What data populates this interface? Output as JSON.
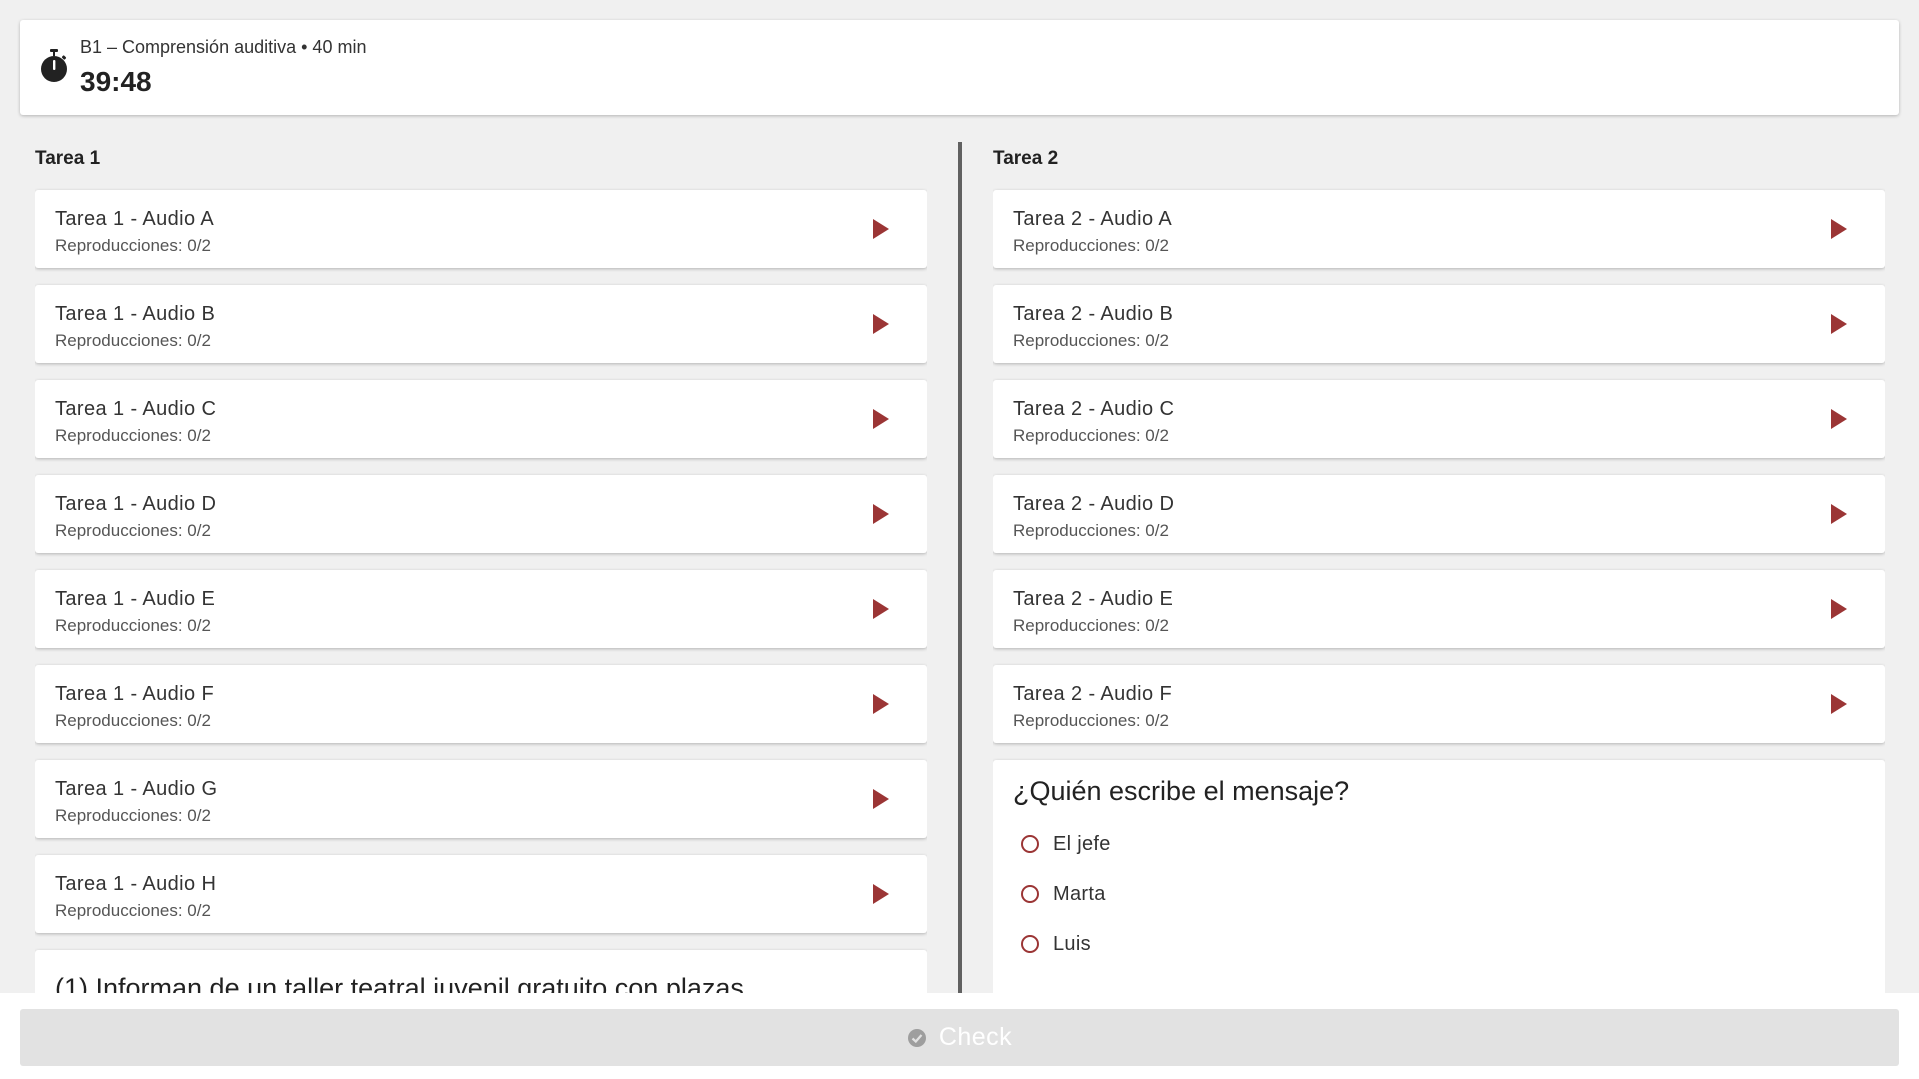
{
  "header": {
    "exam_title": "B1 – Comprensión auditiva • 40 min",
    "countdown": "39:48"
  },
  "colors": {
    "accent": "#9b3535",
    "background": "#f0f0f0",
    "divider": "#616161",
    "check_disabled": "#e2e2e2"
  },
  "icons": {
    "timer": "stopwatch-icon",
    "play": "play-icon",
    "check": "check-circle-icon"
  },
  "tarea1": {
    "title": "Tarea 1",
    "audios": [
      {
        "title": "Tarea 1 - Audio A",
        "plays": "Reproducciones: 0/2"
      },
      {
        "title": "Tarea 1 - Audio B",
        "plays": "Reproducciones: 0/2"
      },
      {
        "title": "Tarea 1 - Audio C",
        "plays": "Reproducciones: 0/2"
      },
      {
        "title": "Tarea 1 - Audio D",
        "plays": "Reproducciones: 0/2"
      },
      {
        "title": "Tarea 1 - Audio E",
        "plays": "Reproducciones: 0/2"
      },
      {
        "title": "Tarea 1 - Audio F",
        "plays": "Reproducciones: 0/2"
      },
      {
        "title": "Tarea 1 - Audio G",
        "plays": "Reproducciones: 0/2"
      },
      {
        "title": "Tarea 1 - Audio H",
        "plays": "Reproducciones: 0/2"
      }
    ],
    "question": "(1) Informan de un taller teatral juvenil gratuito con plazas"
  },
  "tarea2": {
    "title": "Tarea 2",
    "audios": [
      {
        "title": "Tarea 2 - Audio A",
        "plays": "Reproducciones: 0/2"
      },
      {
        "title": "Tarea 2 - Audio B",
        "plays": "Reproducciones: 0/2"
      },
      {
        "title": "Tarea 2 - Audio C",
        "plays": "Reproducciones: 0/2"
      },
      {
        "title": "Tarea 2 - Audio D",
        "plays": "Reproducciones: 0/2"
      },
      {
        "title": "Tarea 2 - Audio E",
        "plays": "Reproducciones: 0/2"
      },
      {
        "title": "Tarea 2 - Audio F",
        "plays": "Reproducciones: 0/2"
      }
    ],
    "question": "¿Quién escribe el mensaje?",
    "options": [
      "El jefe",
      "Marta",
      "Luis"
    ]
  },
  "footer": {
    "check_label": "Check"
  }
}
